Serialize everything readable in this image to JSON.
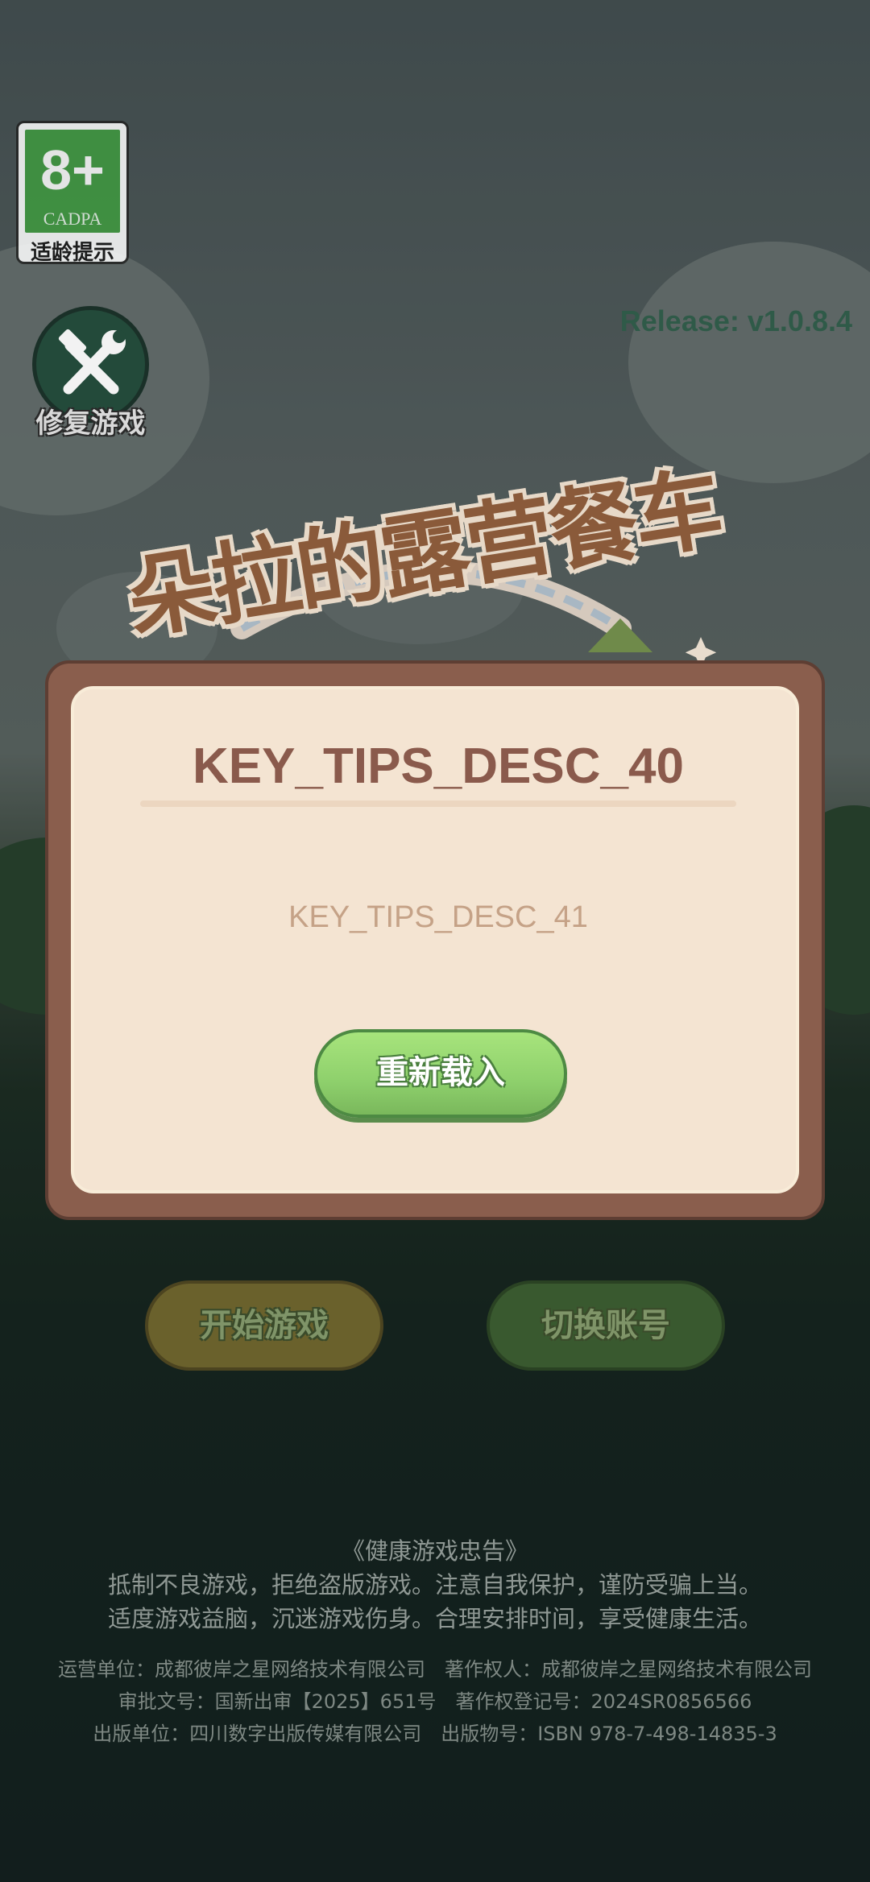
{
  "age_rating": {
    "rating": "8+",
    "organization": "CADPA",
    "label": "适龄提示"
  },
  "repair": {
    "label": "修复游戏",
    "icon": "wrench-hammer-icon"
  },
  "release": "Release: v1.0.8.4",
  "game_title": "朵拉的露营餐车",
  "dialog": {
    "title": "KEY_TIPS_DESC_40",
    "message": "KEY_TIPS_DESC_41",
    "button_label": "重新载入"
  },
  "buttons": {
    "start_game": "开始游戏",
    "switch_account": "切换账号"
  },
  "footer": {
    "notice_title": "《健康游戏忠告》",
    "notice_line1": "抵制不良游戏，拒绝盗版游戏。注意自我保护，谨防受骗上当。",
    "notice_line2": "适度游戏益脑，沉迷游戏伤身。合理安排时间，享受健康生活。",
    "info_line1": "运营单位：成都彼岸之星网络技术有限公司　著作权人：成都彼岸之星网络技术有限公司",
    "info_line2": "审批文号：国新出审【2025】651号　著作权登记号：2024SR0856566",
    "info_line3": "出版单位：四川数字出版传媒有限公司　出版物号：ISBN 978-7-498-14835-3"
  }
}
